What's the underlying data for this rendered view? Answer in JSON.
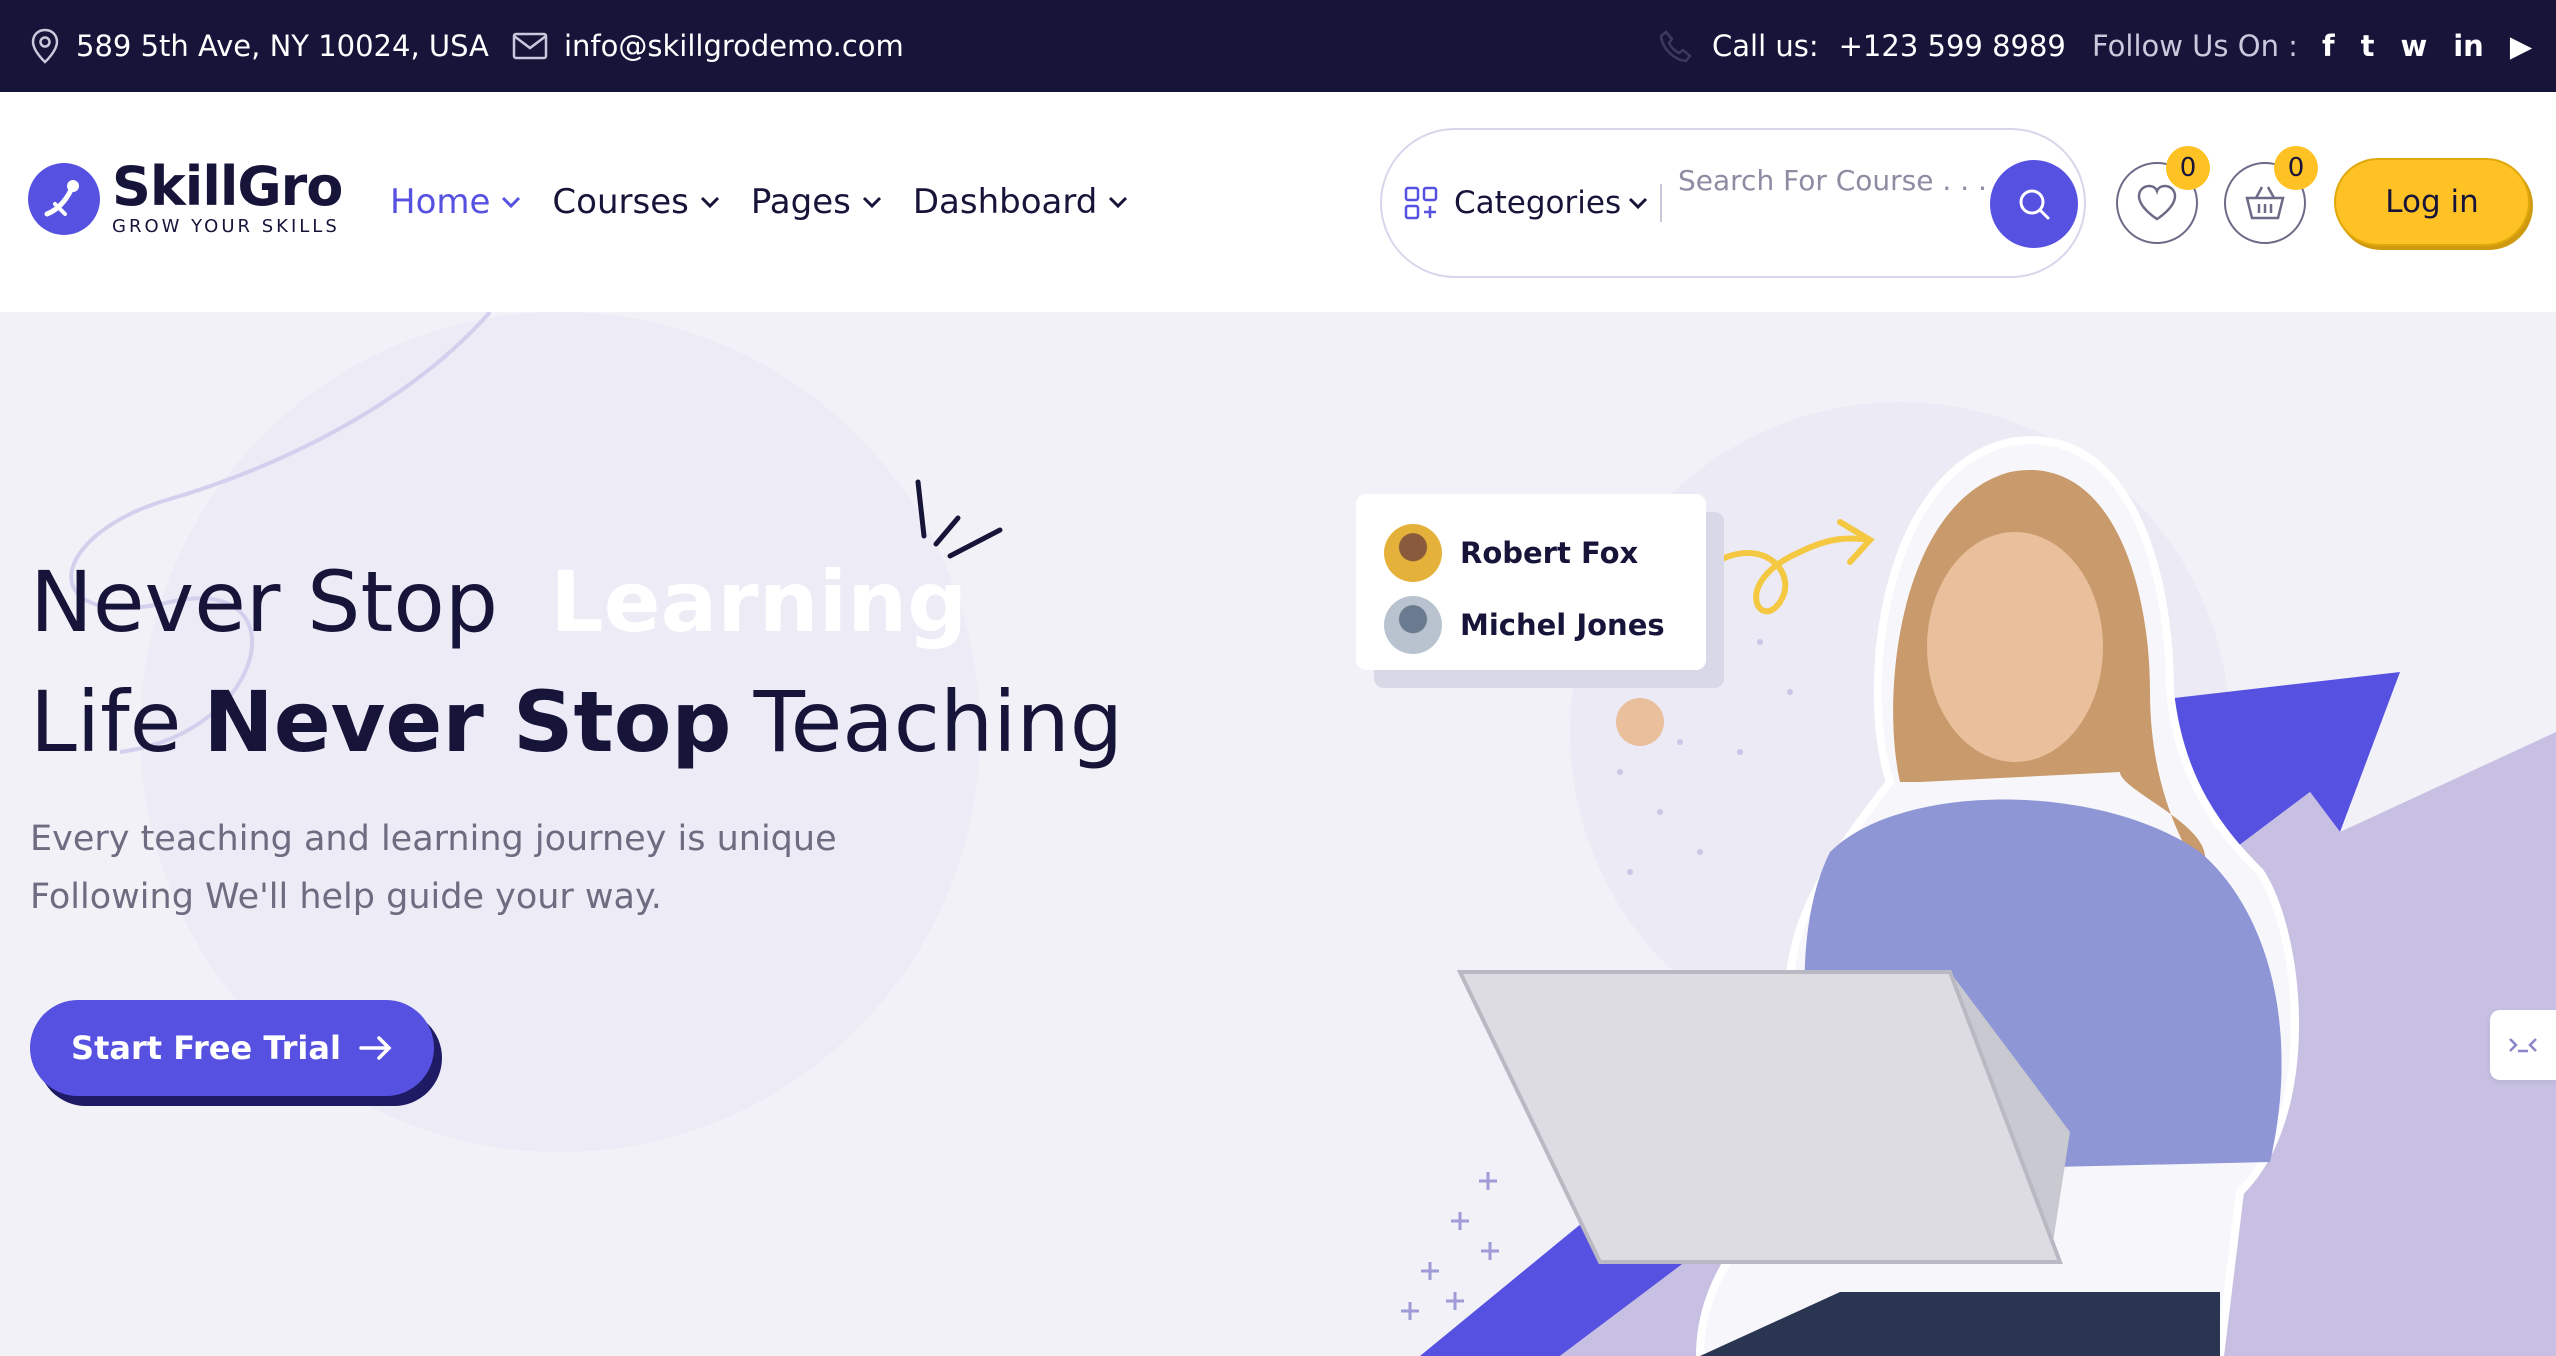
{
  "topbar": {
    "address": "589 5th Ave, NY 10024, USA",
    "email": "info@skillgrodemo.com",
    "call_label": "Call us:",
    "phone": "+123 599 8989",
    "follow_label": "Follow Us On :",
    "social_icons": [
      "facebook-icon",
      "twitter-icon",
      "whatsapp-icon",
      "linkedin-icon",
      "youtube-icon"
    ],
    "social_glyphs": [
      "f",
      "t",
      "w",
      "in",
      "▶"
    ]
  },
  "header": {
    "logo_name": "SkillGro",
    "logo_tagline": "GROW YOUR SKILLS",
    "nav": [
      "Home",
      "Courses",
      "Pages",
      "Dashboard"
    ],
    "categories_label": "Categories",
    "search_placeholder": "Search For Course . . .",
    "wishlist_count": "0",
    "cart_count": "0",
    "login_label": "Log in"
  },
  "hero": {
    "line1_prefix": "Never Stop",
    "line1_highlight": "Learning",
    "line2_prefix": "Life",
    "line2_bold": "Never Stop",
    "line2_suffix": "Teaching",
    "sub_line1": "Every teaching and learning journey is unique",
    "sub_line2": "Following We'll help guide your way.",
    "cta_label": "Start Free Trial",
    "people": [
      "Robert Fox",
      "Michel Jones"
    ]
  },
  "colors": {
    "primary": "#5751e1",
    "accent": "#ffc224",
    "dark": "#161439",
    "hero_bg": "#f2f1f8"
  }
}
